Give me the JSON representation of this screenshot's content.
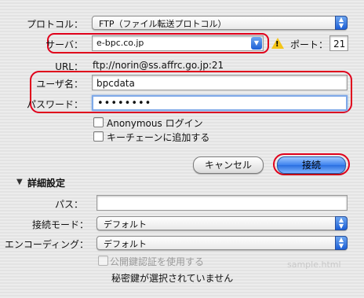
{
  "protocol": {
    "label": "プロトコル：",
    "value": "FTP（ファイル転送プロトコル）"
  },
  "server": {
    "label": "サーバ：",
    "value": "e-bpc.co.jp",
    "warning_icon": "warning-icon"
  },
  "port": {
    "label": "ポート：",
    "value": "21"
  },
  "url": {
    "label": "URL：",
    "value": "ftp://norin@ss.affrc.go.jp:21"
  },
  "username": {
    "label": "ユーザ名：",
    "value": "bpcdata"
  },
  "password": {
    "label": "パスワード：",
    "value": "••••••••"
  },
  "checkboxes": [
    {
      "label": "Anonymous ログイン",
      "checked": false
    },
    {
      "label": "キーチェーンに追加する",
      "checked": false
    }
  ],
  "buttons": {
    "cancel": "キャンセル",
    "connect": "接続"
  },
  "advanced": {
    "title": "詳細設定",
    "path_label": "パス：",
    "path_value": "",
    "mode_label": "接続モード：",
    "mode_value": "デフォルト",
    "encoding_label": "エンコーディング：",
    "encoding_value": "デフォルト",
    "public_key_label": "公開鍵認証を使用する",
    "private_key_status": "秘密鍵が選択されていません"
  },
  "watermark": "sample.html",
  "colors": {
    "highlight": "#e0001b",
    "accent": "#2a6fe0",
    "focus": "#7fa9e8"
  }
}
